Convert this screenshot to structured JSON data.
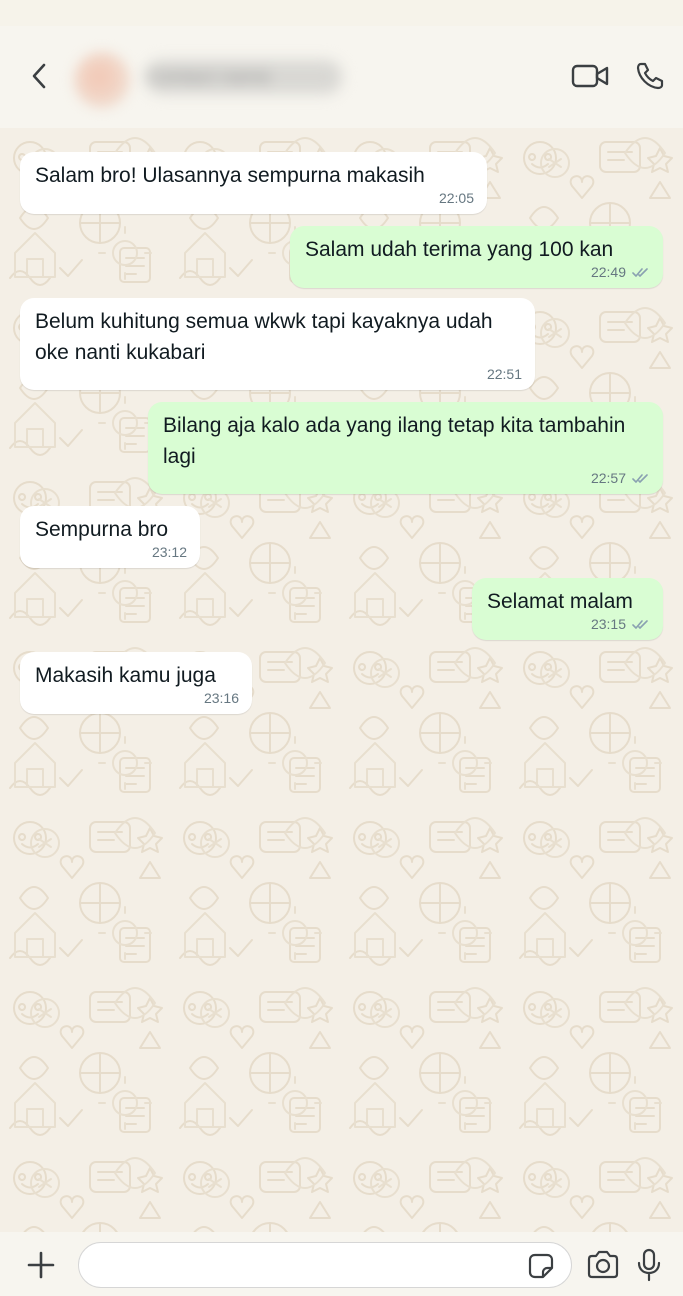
{
  "header": {
    "contact_name": "Contact name",
    "back_icon": "chevron-left-icon",
    "video_icon": "video-camera-icon",
    "phone_icon": "phone-icon"
  },
  "messages": [
    {
      "direction": "in",
      "text": "Salam bro! Ulasannya sempurna makasih",
      "time": "22:05"
    },
    {
      "direction": "out",
      "text": "Salam udah terima yang 100 kan",
      "time": "22:49",
      "status": "read"
    },
    {
      "direction": "in",
      "text": "Belum kuhitung semua wkwk tapi kayaknya udah oke nanti kukabari",
      "time": "22:51"
    },
    {
      "direction": "out",
      "text": "Bilang aja kalo ada yang ilang tetap kita tambahin lagi",
      "time": "22:57",
      "status": "read"
    },
    {
      "direction": "in",
      "text": "Sempurna bro",
      "time": "23:12"
    },
    {
      "direction": "out",
      "text": "Selamat malam",
      "time": "23:15",
      "status": "read"
    },
    {
      "direction": "in",
      "text": "Makasih kamu juga",
      "time": "23:16"
    }
  ],
  "composer": {
    "input_value": "",
    "input_placeholder": "",
    "plus_icon": "plus-icon",
    "sticker_icon": "sticker-icon",
    "camera_icon": "camera-icon",
    "mic_icon": "microphone-icon"
  },
  "colors": {
    "incoming_bubble": "#ffffff",
    "outgoing_bubble": "#d9fdd3",
    "chat_background": "#f4efe6",
    "icon": "#3b3f42",
    "timestamp": "#667781"
  }
}
